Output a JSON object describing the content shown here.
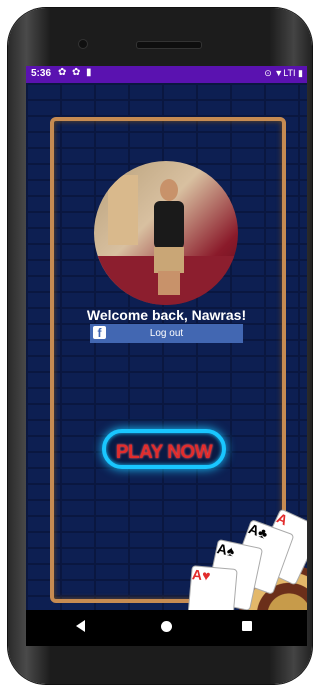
{
  "statusbar": {
    "time": "5:36",
    "icons_left": [
      "settings-icon",
      "settings-icon",
      "sd-card-icon"
    ],
    "icons_right_text": "⊙ ▼LTI ▮"
  },
  "welcome_text": "Welcome back, Nawras!",
  "facebook_button": {
    "label": "Log out",
    "icon_letter": "f"
  },
  "play_button": {
    "label": "PLAY NOW"
  },
  "colors": {
    "statusbar": "#5a12b0",
    "frame": "#c68b52",
    "neon": "#19c6ff",
    "play_text": "#e22c2c",
    "facebook": "#4267b2"
  },
  "cards": [
    "A♠",
    "A♥",
    "A♣",
    "A"
  ]
}
